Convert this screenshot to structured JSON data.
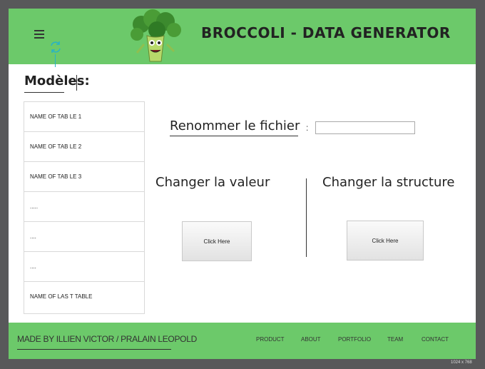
{
  "header": {
    "title": "BROCCOLI - DATA GENERATOR",
    "menu_icon": "hamburger-menu-icon",
    "refresh_icon": "refresh-icon",
    "logo": "broccoli-mascot-logo"
  },
  "models": {
    "title": "Modèles",
    "colon": ":",
    "items": [
      "NAME OF TAB  LE 1",
      "NAME OF TAB  LE 2",
      "NAME OF TAB  LE 3",
      ".....",
      "....",
      "....",
      "NAME OF LAS   T TABLE"
    ]
  },
  "rename": {
    "label": "Renommer le fichier",
    "colon": ":",
    "value": ""
  },
  "change_value": {
    "label": "Changer la valeur",
    "button": "Click Here"
  },
  "change_structure": {
    "label": "Changer la  structure",
    "button": "Click Here"
  },
  "footer": {
    "credit": "MADE BY ILLIEN VICTOR / PRALAIN LEOPOLD",
    "links": [
      "PRODUCT",
      "ABOUT",
      "PORTFOLIO",
      "TEAM",
      "CONTACT"
    ]
  },
  "size_badge": "1024 x 768",
  "colors": {
    "header_bg": "#6cc96a",
    "frame_bg": "#58585a",
    "accent": "#27b3c6"
  }
}
